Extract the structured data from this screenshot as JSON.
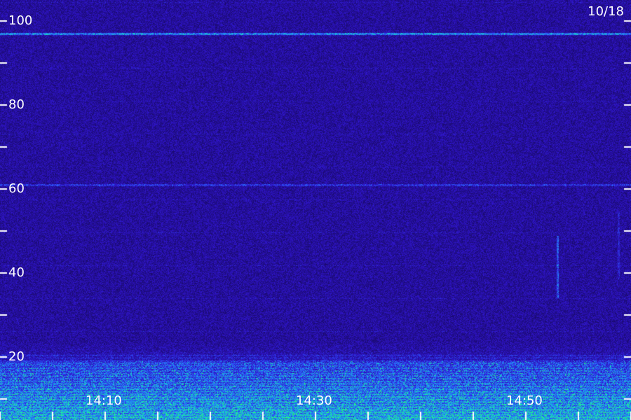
{
  "chart_data": {
    "type": "heatmap",
    "title": "",
    "date": "10/18",
    "xlabel": "",
    "ylabel": "",
    "x_tick_labels": [
      "14:10",
      "14:30",
      "14:50"
    ],
    "y_tick_labels": [
      "20",
      "40",
      "60",
      "80",
      "100"
    ],
    "ylim": [
      0,
      100
    ],
    "grid": false,
    "colormap": [
      "#000010",
      "#1a0a6e",
      "#2f14c8",
      "#2b62ff",
      "#14d2d2",
      "#2cff66"
    ],
    "features": [
      {
        "kind": "horizontal-line",
        "y": 97,
        "intensity": "high"
      },
      {
        "kind": "horizontal-line",
        "y": 61,
        "intensity": "medium"
      },
      {
        "kind": "vertical-streak",
        "x": "14:53",
        "y_range": [
          34,
          49
        ]
      },
      {
        "kind": "band",
        "y_range": [
          0,
          13
        ],
        "intensity": "high"
      }
    ]
  },
  "colors": {
    "background": "#16086a",
    "text": "#ffffff"
  }
}
